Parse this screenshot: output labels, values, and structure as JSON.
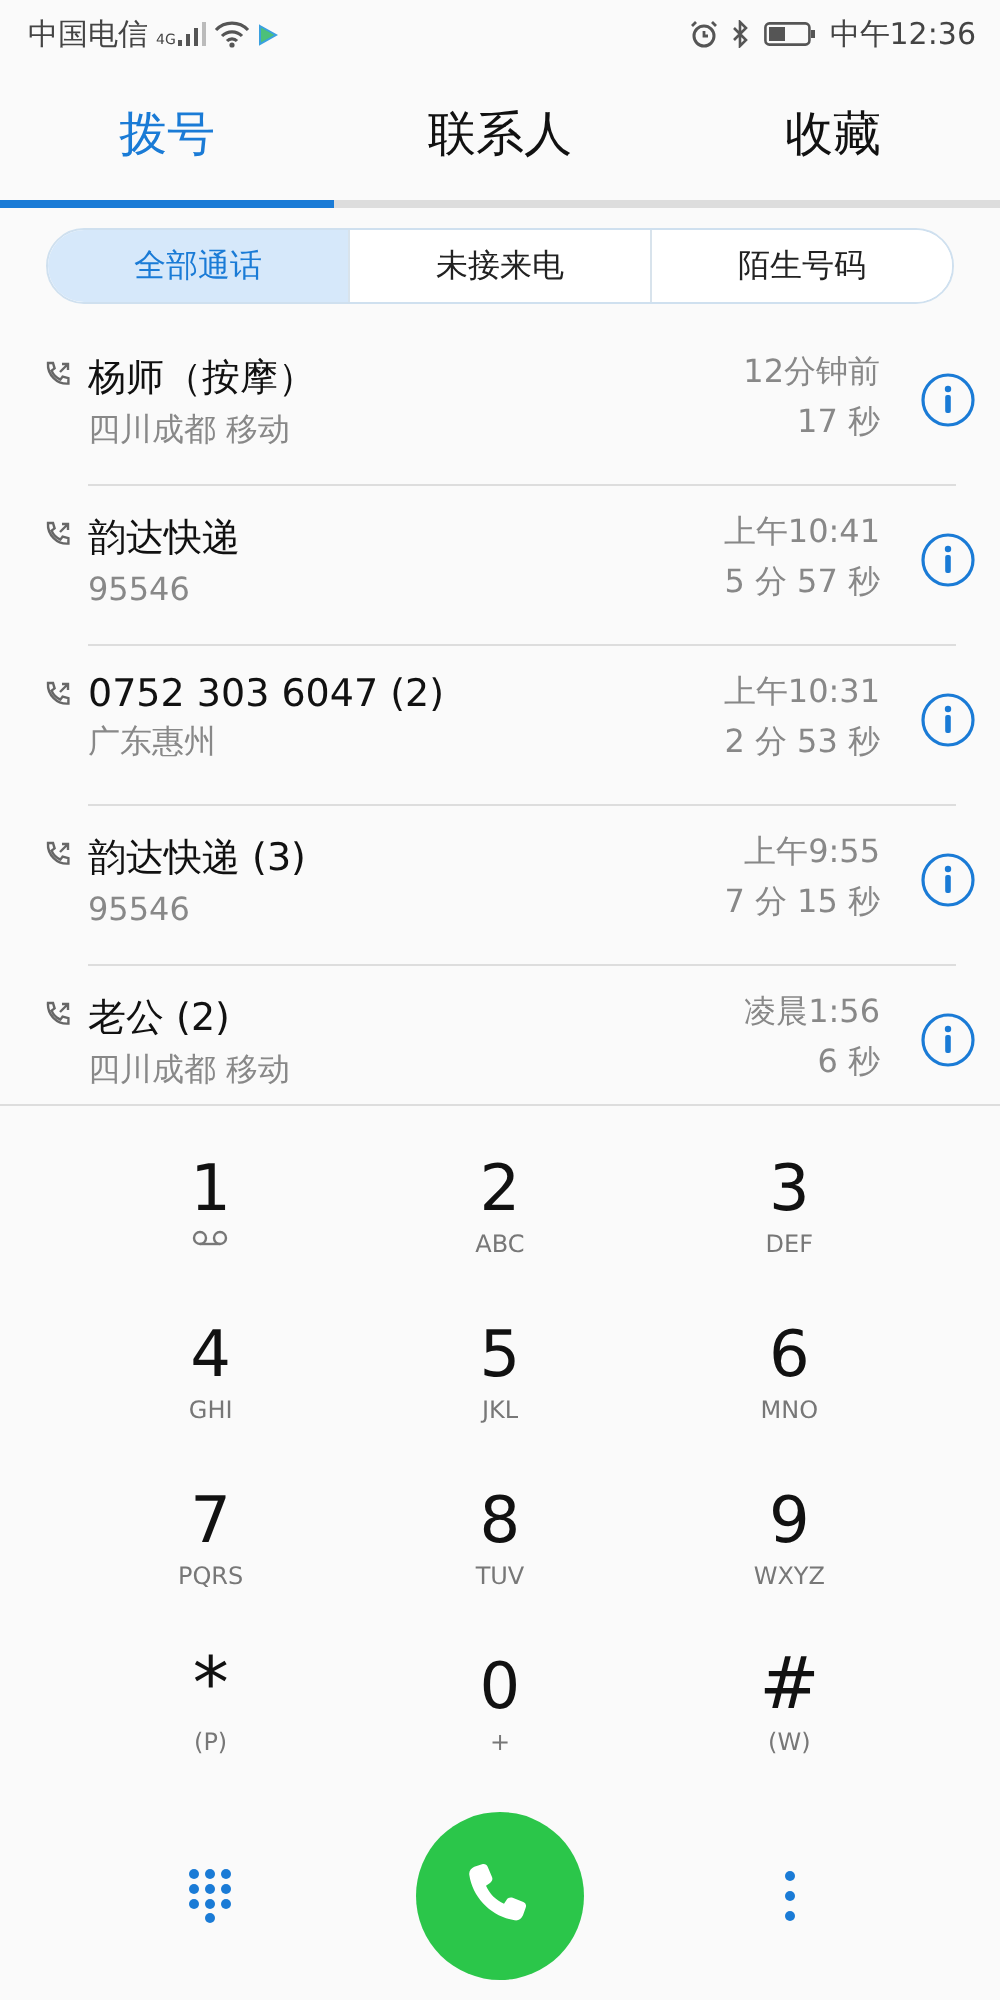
{
  "status_bar": {
    "carrier": "中国电信",
    "network": "4G",
    "time": "中午12:36"
  },
  "tabs": [
    {
      "label": "拨号",
      "selected": true
    },
    {
      "label": "联系人",
      "selected": false
    },
    {
      "label": "收藏",
      "selected": false
    }
  ],
  "filters": [
    {
      "label": "全部通话",
      "selected": true
    },
    {
      "label": "未接来电",
      "selected": false
    },
    {
      "label": "陌生号码",
      "selected": false
    }
  ],
  "calls": [
    {
      "name": "杨师（按摩）",
      "detail": "四川成都 移动",
      "time": "12分钟前",
      "duration": "17 秒"
    },
    {
      "name": "韵达快递",
      "detail": "95546",
      "time": "上午10:41",
      "duration": "5 分 57 秒"
    },
    {
      "name": "0752 303 6047 (2)",
      "detail": "广东惠州",
      "time": "上午10:31",
      "duration": "2 分 53 秒"
    },
    {
      "name": "韵达快递 (3)",
      "detail": "95546",
      "time": "上午9:55",
      "duration": "7 分 15 秒"
    },
    {
      "name": "老公 (2)",
      "detail": "四川成都 移动",
      "time": "凌晨1:56",
      "duration": "6 秒"
    }
  ],
  "keypad": [
    {
      "digit": "1",
      "kind": "voicemail"
    },
    {
      "digit": "2",
      "sub": "ABC",
      "kind": "text"
    },
    {
      "digit": "3",
      "sub": "DEF",
      "kind": "text"
    },
    {
      "digit": "4",
      "sub": "GHI",
      "kind": "text"
    },
    {
      "digit": "5",
      "sub": "JKL",
      "kind": "text"
    },
    {
      "digit": "6",
      "sub": "MNO",
      "kind": "text"
    },
    {
      "digit": "7",
      "sub": "PQRS",
      "kind": "text"
    },
    {
      "digit": "8",
      "sub": "TUV",
      "kind": "text"
    },
    {
      "digit": "9",
      "sub": "WXYZ",
      "kind": "text"
    },
    {
      "digit": "*",
      "sub": "(P)",
      "kind": "text"
    },
    {
      "digit": "0",
      "sub": "+",
      "kind": "text"
    },
    {
      "digit": "#",
      "sub": "(W)",
      "kind": "text"
    }
  ]
}
